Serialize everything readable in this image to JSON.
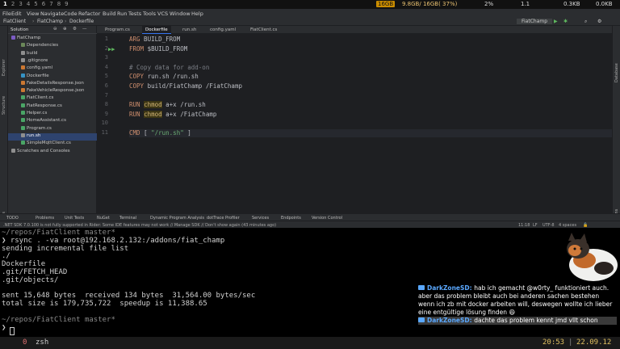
{
  "system_bar": {
    "workspaces": [
      "1",
      "2",
      "3",
      "4",
      "5",
      "6",
      "7",
      "8",
      "9"
    ],
    "memory": "16GB",
    "mem_usage": "9.8GB/ 16GB( 37%)",
    "cpu": "2%",
    "load": "1.1",
    "net_up": "0.3KB",
    "net_down": "0.0KB"
  },
  "menu": {
    "items": [
      "File",
      "Edit",
      "View",
      "Navigate",
      "Code",
      "Refactor",
      "Build",
      "Run",
      "Tests",
      "Tools",
      "VCS",
      "Window",
      "Help"
    ]
  },
  "nav": {
    "crumbs": [
      "FiatClient",
      "FiatChamp",
      "Dockerfile"
    ],
    "run_config": "FiatChamp"
  },
  "solution": {
    "title": "Solution",
    "items": [
      {
        "label": "FiatChamp",
        "level": 0,
        "color": "#7c5cc4"
      },
      {
        "label": "Dependencies",
        "level": 1,
        "color": "#6a8759"
      },
      {
        "label": "build",
        "level": 1,
        "color": "#8f8f8f"
      },
      {
        "label": ".gitignore",
        "level": 1,
        "color": "#8f8f8f"
      },
      {
        "label": "config.yaml",
        "level": 1,
        "color": "#cc7832"
      },
      {
        "label": "Dockerfile",
        "level": 1,
        "color": "#3592c4"
      },
      {
        "label": "FakeDetailsResponse.json",
        "level": 1,
        "color": "#cc7832"
      },
      {
        "label": "FakeVehicleResponse.json",
        "level": 1,
        "color": "#cc7832"
      },
      {
        "label": "FiatClient.cs",
        "level": 1,
        "color": "#4aa566"
      },
      {
        "label": "FiatResponse.cs",
        "level": 1,
        "color": "#4aa566"
      },
      {
        "label": "Helper.cs",
        "level": 1,
        "color": "#4aa566"
      },
      {
        "label": "HomeAssistant.cs",
        "level": 1,
        "color": "#4aa566"
      },
      {
        "label": "Program.cs",
        "level": 1,
        "color": "#4aa566"
      },
      {
        "label": "run.sh",
        "level": 1,
        "color": "#8f8f8f",
        "selected": true
      },
      {
        "label": "SimpleMqttClient.cs",
        "level": 1,
        "color": "#4aa566"
      },
      {
        "label": "Scratches and Consoles",
        "level": 0,
        "color": "#8f8f8f"
      }
    ]
  },
  "tabs": [
    {
      "label": "Program.cs"
    },
    {
      "label": "Dockerfile",
      "active": true
    },
    {
      "label": "run.sh"
    },
    {
      "label": "config.yaml"
    },
    {
      "label": "FiatClient.cs"
    }
  ],
  "code_lines": [
    {
      "n": "1",
      "parts": [
        [
          "kw",
          "ARG"
        ],
        [
          "",
          " BUILD_FROM"
        ]
      ]
    },
    {
      "n": "2",
      "parts": [
        [
          "kw",
          "FROM"
        ],
        [
          "",
          " $BUILD_FROM"
        ]
      ]
    },
    {
      "n": "3",
      "parts": []
    },
    {
      "n": "4",
      "parts": [
        [
          "cm",
          "# Copy data for add-on"
        ]
      ]
    },
    {
      "n": "5",
      "parts": [
        [
          "kw",
          "COPY"
        ],
        [
          "",
          " run.sh /run.sh"
        ]
      ]
    },
    {
      "n": "6",
      "parts": [
        [
          "kw",
          "COPY"
        ],
        [
          "",
          " build/FiatChamp /FiatChamp"
        ]
      ]
    },
    {
      "n": "7",
      "parts": []
    },
    {
      "n": "8",
      "parts": [
        [
          "kw",
          "RUN"
        ],
        [
          "",
          " "
        ],
        [
          "hl",
          "chmod"
        ],
        [
          "",
          " a+x /run.sh"
        ]
      ]
    },
    {
      "n": "9",
      "parts": [
        [
          "kw",
          "RUN"
        ],
        [
          "",
          " "
        ],
        [
          "hl",
          "chmod"
        ],
        [
          "",
          " a+x /FiatChamp"
        ]
      ]
    },
    {
      "n": "10",
      "parts": []
    },
    {
      "n": "11",
      "parts": [
        [
          "kw",
          "CMD"
        ],
        [
          "",
          " [ "
        ],
        [
          "str",
          "\"/run.sh\""
        ],
        [
          "",
          " ]"
        ]
      ]
    }
  ],
  "tool_windows": [
    "TODO",
    "Problems",
    "Unit Tests",
    "NuGet",
    "Terminal",
    "Dynamic Program Analysis",
    "dotTrace Profiler",
    "Services",
    "Endpoints",
    "Version Control"
  ],
  "status": {
    "message": ".NET SDK 7.0.100 is not fully supported in Rider: Some IDE features may not work // Manage SDK // Don't show again (43 minutes ago)",
    "position": "11:18",
    "line_ending": "LF",
    "encoding": "UTF-8",
    "indent": "4 spaces"
  },
  "terminal": {
    "lines": [
      {
        "t": "~/repos/FiatClient master*",
        "c": "dim"
      },
      {
        "t": "❯ rsync . -va root@192.168.2.132:/addons/fiat_champ",
        "c": ""
      },
      {
        "t": "sending incremental file list",
        "c": ""
      },
      {
        "t": "./",
        "c": ""
      },
      {
        "t": "Dockerfile",
        "c": ""
      },
      {
        "t": ".git/FETCH_HEAD",
        "c": ""
      },
      {
        "t": ".git/objects/",
        "c": ""
      },
      {
        "t": "",
        "c": ""
      },
      {
        "t": "sent 15,648 bytes  received 134 bytes  31,564.00 bytes/sec",
        "c": ""
      },
      {
        "t": "total size is 179,735,722  speedup is 11,388.65",
        "c": ""
      },
      {
        "t": "",
        "c": ""
      },
      {
        "t": "~/repos/FiatClient master*",
        "c": "dim"
      },
      {
        "t": "❯",
        "c": ""
      }
    ]
  },
  "chat": [
    {
      "name": "DarkZoneSD:",
      "text": "hab ich gemacht @w0rty_ funktioniert auch. aber das problem bleibt auch bei anderen sachen bestehen wenn ich zb mit docker arbeiten will, deswegen wollte ich lieber eine entgültige lösung finden 😄"
    },
    {
      "name": "DarkZoneSD:",
      "text": "dachte das problem kennt jmd vllt schon"
    }
  ],
  "tmux": {
    "window_index": "0",
    "window_name": "zsh",
    "time": "20:53",
    "date": "22.09.12"
  }
}
